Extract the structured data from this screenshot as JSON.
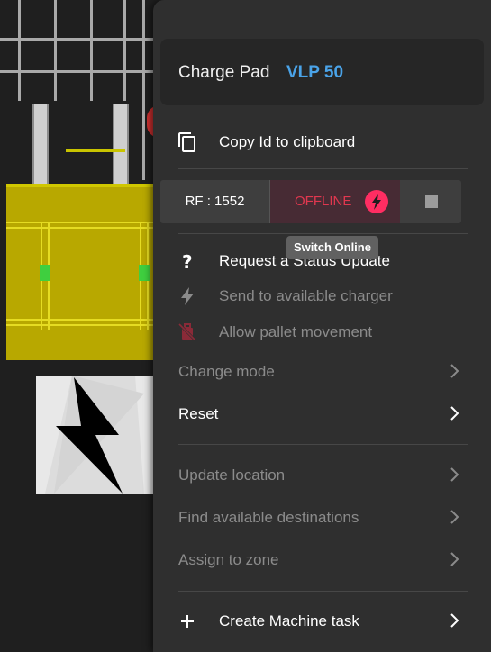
{
  "header": {
    "type_label": "Charge Pad",
    "name_label": "VLP 50"
  },
  "menu": {
    "copy_id": "Copy Id to clipboard",
    "rf_label": "RF : 1552",
    "status_label": "OFFLINE",
    "tooltip": "Switch Online",
    "request_status": "Request a Status Update",
    "send_to_charger": "Send to available charger",
    "allow_pallet": "Allow pallet movement",
    "change_mode": "Change mode",
    "reset": "Reset",
    "update_location": "Update location",
    "find_destinations": "Find available destinations",
    "assign_zone": "Assign to zone",
    "create_task": "Create Machine task"
  },
  "colors": {
    "accent_blue": "#4aa3e8",
    "offline_red": "#e1374f",
    "bolt_pink": "#ff2d62",
    "menu_bg": "#2f2f2f"
  },
  "icons": [
    "copy-icon",
    "lightning-icon",
    "stop-icon",
    "question-icon",
    "flash-icon",
    "no-luggage-icon",
    "chevron-right-icon",
    "plus-icon"
  ]
}
